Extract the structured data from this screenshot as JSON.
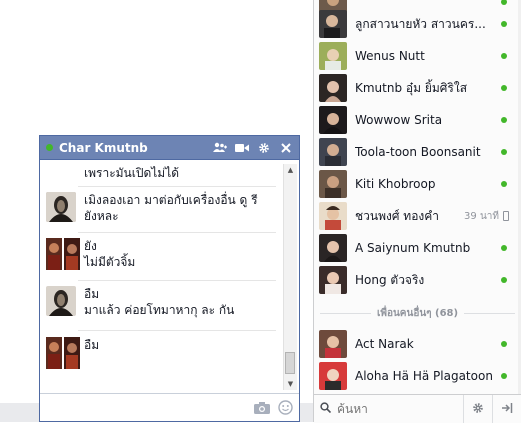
{
  "chat": {
    "title": "Char Kmutnb",
    "messages": [
      {
        "lines": [
          "เพราะมันเปิดไม่ได้"
        ]
      },
      {
        "lines": [
          "เมิงลองเอา มาต่อกับเครื่องอื่น ดู รี",
          "ยังหละ"
        ]
      },
      {
        "lines": [
          "ยัง",
          "ไม่มีตัวจิ้ม"
        ]
      },
      {
        "lines": [
          "อืม",
          "มาแล้ว ค่อยโทมาหากุ ละ กัน"
        ]
      },
      {
        "lines": [
          "อืม"
        ]
      }
    ],
    "input_placeholder": ""
  },
  "sidebar": {
    "contacts": [
      {
        "name": "",
        "online": true
      },
      {
        "name": "ลูกสาวนายหัว สาวนคร...",
        "online": true
      },
      {
        "name": "Wenus Nutt",
        "online": true
      },
      {
        "name": "Kmutnb อุ๋ม ยิ้มศิริใส",
        "online": true
      },
      {
        "name": "Wowwow Srita",
        "online": true
      },
      {
        "name": "Toola-toon Boonsanit",
        "online": true
      },
      {
        "name": "Kiti Khobroop",
        "online": true
      },
      {
        "name": "ชวนพงศ์ ทองคำ",
        "online": false,
        "idle": "39 นาที"
      },
      {
        "name": "A Saiynum Kmutnb",
        "online": true
      },
      {
        "name": "Hong ตัวจริง",
        "online": true
      }
    ],
    "section_title": "เพื่อนคนอื่นๆ (68)",
    "other_contacts": [
      {
        "name": "Act Narak",
        "online": true
      },
      {
        "name": "Aloha Hä Hä Plagatoon",
        "online": true
      }
    ],
    "search_placeholder": "ค้นหา"
  },
  "colors": {
    "header_bg": "#6d84b4",
    "online": "#42b72a"
  }
}
